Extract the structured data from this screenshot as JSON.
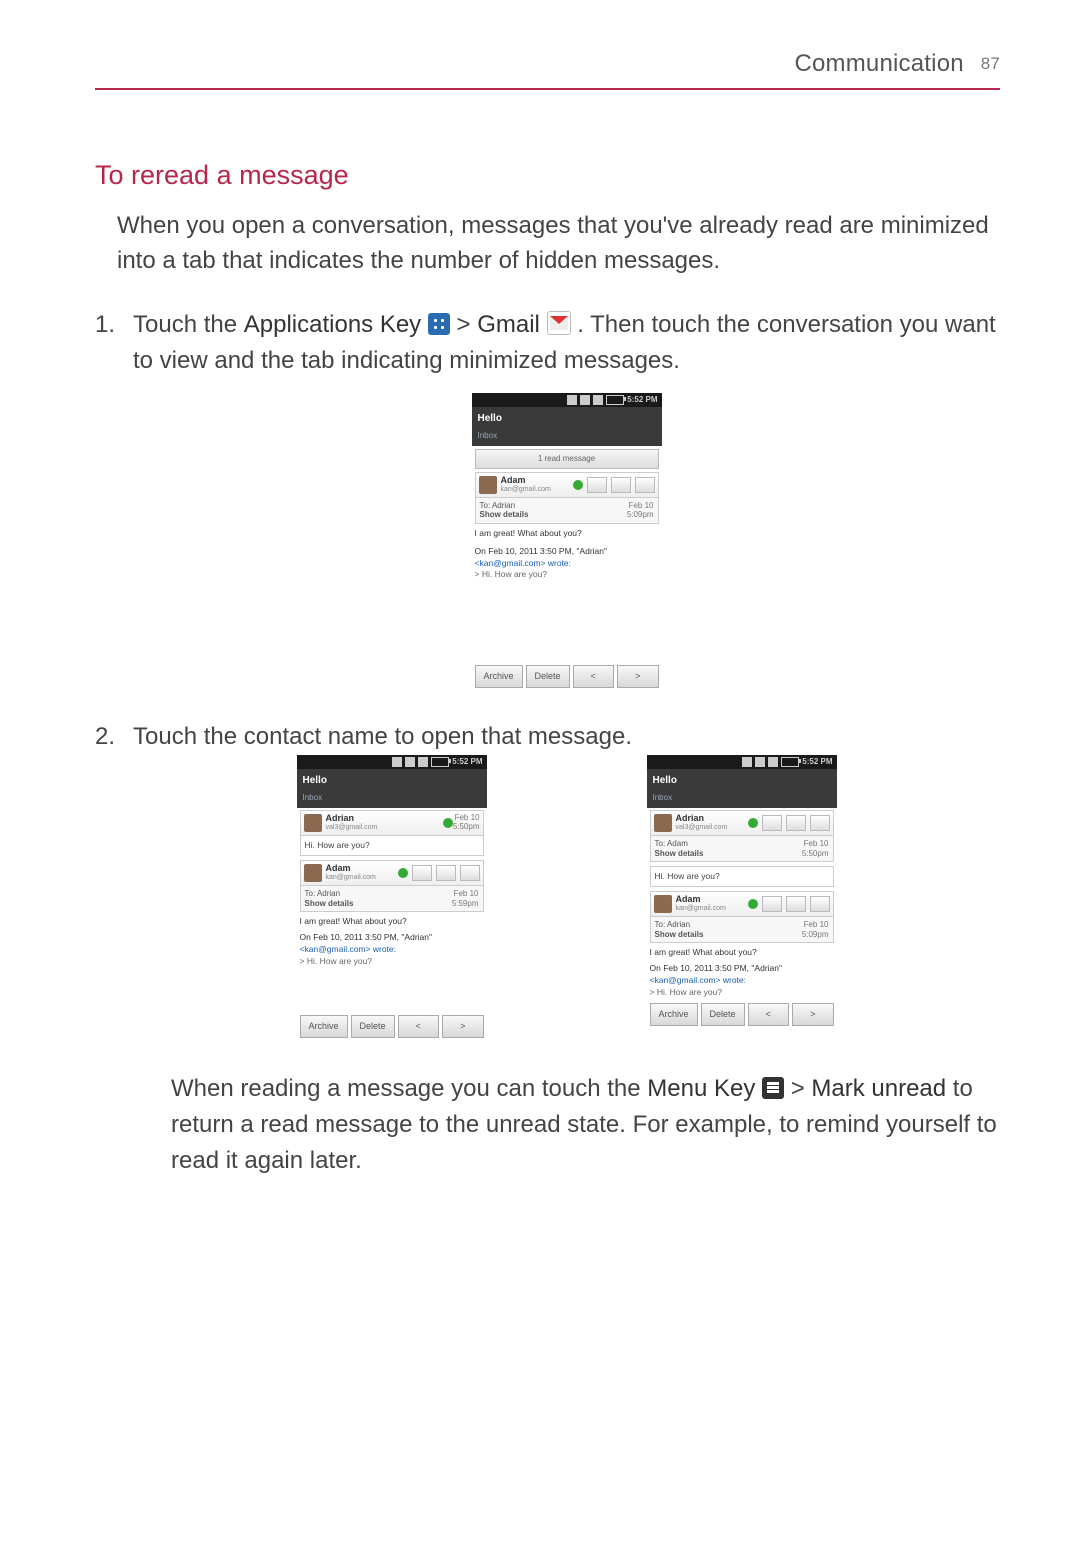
{
  "header": {
    "section": "Communication",
    "page_number": "87"
  },
  "title": "To reread a message",
  "intro": "When you open a conversation, messages that you've already read are minimized into a tab that indicates the number of hidden messages.",
  "steps": {
    "s1a": "Touch the ",
    "s1_apps": "Applications Key",
    "s1b": " > ",
    "s1_gmail": "Gmail",
    "s1c": ". Then touch the conversation you want to view and the tab indicating minimized messages.",
    "s2": "Touch the contact name to open that message."
  },
  "footer": {
    "a": "When reading a message you can touch the ",
    "menu": "Menu Key",
    "b": " > ",
    "mark": "Mark unread",
    "c": " to return a read message to the unread state. For example, to remind yourself to read it again later."
  },
  "phone": {
    "time": "5:52 PM",
    "conv_title": "Hello",
    "inbox": "Inbox",
    "read_bar": "1 read message",
    "adam": "Adam",
    "adam_mail": "kan@gmail.com",
    "adrian": "Adrian",
    "adrian_mail": "val3@gmail.com",
    "to_adrian": "To: Adrian",
    "to_adam": "To: Adam",
    "show_details": "Show details",
    "date": "Feb 10",
    "time1": "5:09pm",
    "time2": "5:50pm",
    "time3": "5:59pm",
    "body_great": "I am great! What about you?",
    "body_quote1": "On Feb 10, 2011 3:50 PM, \"Adrian\"",
    "body_quote2": "<kan@gmail.com> wrote:",
    "body_quote3": "> Hi. How are you?",
    "hi_how": "Hi. How are you?",
    "archive": "Archive",
    "delete": "Delete",
    "prev": "<",
    "next": ">"
  }
}
